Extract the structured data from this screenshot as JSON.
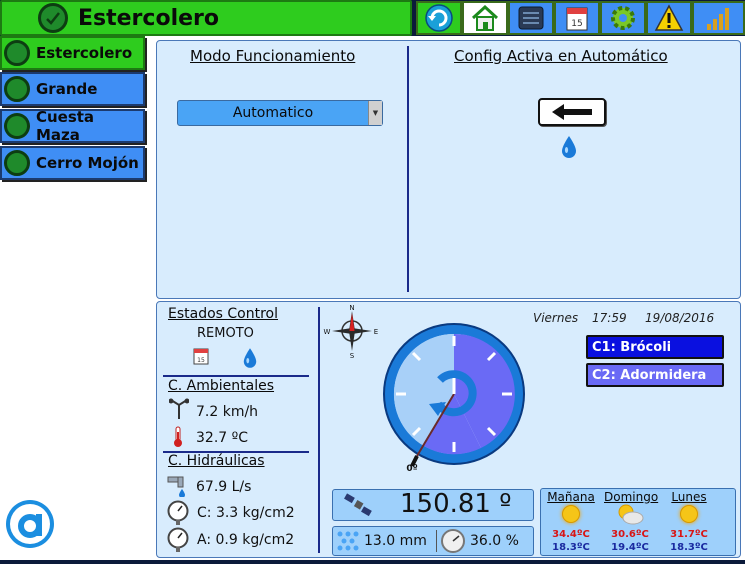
{
  "header": {
    "title": "Estercolero"
  },
  "toolbar": [
    {
      "name": "refresh-icon",
      "color": "#2ecc1e"
    },
    {
      "name": "home-icon",
      "color": "#ffffff"
    },
    {
      "name": "list-icon",
      "color": "#3f8ef5"
    },
    {
      "name": "calendar-icon",
      "color": "#3f8ef5"
    },
    {
      "name": "gear-icon",
      "color": "#3f8ef5"
    },
    {
      "name": "warning-icon",
      "color": "#3f8ef5"
    },
    {
      "name": "signal-bars-icon",
      "color": "#3f8ef5"
    }
  ],
  "sidebar": {
    "items": [
      {
        "label": "Estercolero",
        "active": true
      },
      {
        "label": "Grande",
        "active": false
      },
      {
        "label": "Cuesta Maza",
        "active": false
      },
      {
        "label": "Cerro Mojón",
        "active": false
      }
    ]
  },
  "mode_panel": {
    "title": "Modo Funcionamiento",
    "select_value": "Automatico",
    "active_config_title": "Config Activa en Automático"
  },
  "status_panel": {
    "estados_title": "Estados Control",
    "estado_value": "REMOTO",
    "ambientales_title": "C. Ambientales",
    "wind_speed": "7.2 km/h",
    "temperature": "32.7 ºC",
    "hidraulicas_title": "C. Hidráulicas",
    "flow": "67.9 L/s",
    "pressure_c": "C: 3.3 kg/cm2",
    "pressure_a": "A: 0.9 kg/cm2",
    "day_name": "Viernes",
    "time": "17:59",
    "date": "19/08/2016",
    "crops": [
      {
        "label": "C1: Brócoli",
        "color": "#0a10e0"
      },
      {
        "label": "C2: Adormidera",
        "color": "#6a6af5"
      }
    ],
    "compass": {
      "n": "N",
      "s": "S",
      "e": "E",
      "w": "W"
    },
    "gauge_zero_label": "0º",
    "angle_value": "150.81 º",
    "rain": "13.0 mm",
    "humidity": "36.0 %",
    "forecast": [
      {
        "day": "Mañana",
        "max": "34.4ºC",
        "min": "18.3ºC"
      },
      {
        "day": "Domingo",
        "max": "30.6ºC",
        "min": "19.4ºC"
      },
      {
        "day": "Lunes",
        "max": "31.7ºC",
        "min": "18.3ºC"
      }
    ]
  }
}
